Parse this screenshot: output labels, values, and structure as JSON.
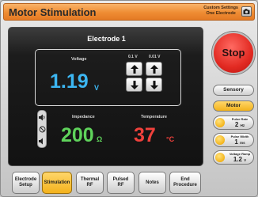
{
  "header": {
    "title": "Motor Stimulation",
    "custom_settings_line1": "Custom Settings",
    "custom_settings_line2": "One Electrode",
    "camera_icon": "camera-icon"
  },
  "main": {
    "electrode_title": "Electrode 1",
    "voltage": {
      "label": "Voltage",
      "value": "1.19",
      "unit": "V",
      "step_coarse_label": "0.1 V",
      "step_fine_label": "0.01 V"
    },
    "impedance": {
      "label": "Impedance",
      "value": "200",
      "unit": "Ω"
    },
    "temperature": {
      "label": "Temperature",
      "value": "37",
      "unit": "°C"
    },
    "sound_icons": [
      "volume-up-icon",
      "mute-icon",
      "volume-down-icon"
    ],
    "colors": {
      "voltage": "#3cb6f2",
      "impedance": "#5fd35b",
      "temperature": "#f0413c"
    }
  },
  "controls": {
    "stop_label": "Stop",
    "sensory_label": "Sensory",
    "motor_label": "Motor",
    "pulse_rate": {
      "label": "Pulse Rate",
      "value": "2",
      "unit": "Hz"
    },
    "pulse_width": {
      "label": "Pulse Width",
      "value": "1",
      "unit": "ms"
    },
    "voltage_ramp": {
      "label": "Voltage Ramp",
      "value": "1.2",
      "unit": "V"
    }
  },
  "tabs": [
    {
      "line1": "Electrode",
      "line2": "Setup",
      "active": false
    },
    {
      "line1": "Stimulation",
      "line2": "",
      "active": true
    },
    {
      "line1": "Thermal",
      "line2": "RF",
      "active": false
    },
    {
      "line1": "Pulsed",
      "line2": "RF",
      "active": false
    },
    {
      "line1": "Notes",
      "line2": "",
      "active": false
    },
    {
      "line1": "End",
      "line2": "Procedure",
      "active": false
    }
  ]
}
